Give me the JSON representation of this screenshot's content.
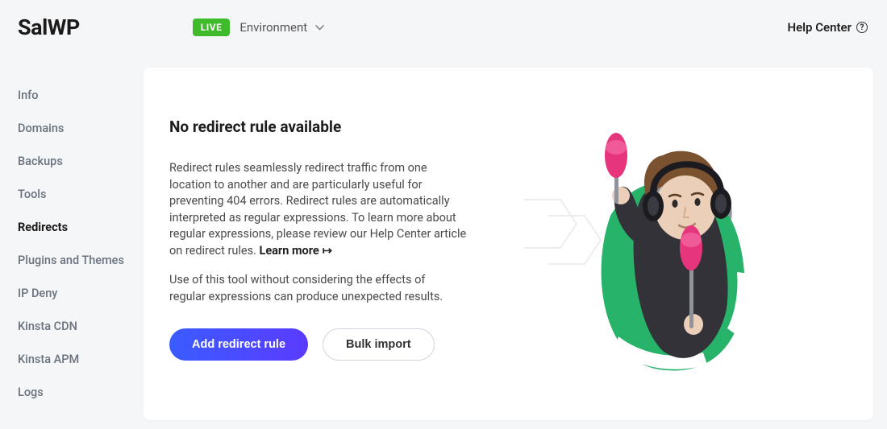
{
  "header": {
    "logo": "SalWP",
    "env_badge": "LIVE",
    "env_label": "Environment",
    "help_label": "Help Center",
    "help_glyph": "?"
  },
  "sidebar": {
    "items": [
      {
        "label": "Info",
        "active": false
      },
      {
        "label": "Domains",
        "active": false
      },
      {
        "label": "Backups",
        "active": false
      },
      {
        "label": "Tools",
        "active": false
      },
      {
        "label": "Redirects",
        "active": true
      },
      {
        "label": "Plugins and Themes",
        "active": false
      },
      {
        "label": "IP Deny",
        "active": false
      },
      {
        "label": "Kinsta CDN",
        "active": false
      },
      {
        "label": "Kinsta APM",
        "active": false
      },
      {
        "label": "Logs",
        "active": false
      }
    ]
  },
  "panel": {
    "title": "No redirect rule available",
    "description": "Redirect rules seamlessly redirect traffic from one location to another and are particularly useful for preventing 404 errors. Redirect rules are automatically interpreted as regular expressions. To learn more about regular expressions, please review our Help Center article on redirect rules. ",
    "learn_more": "Learn more",
    "warning": "Use of this tool without considering the effects of regular expressions can produce unexpected results.",
    "primary_btn": "Add redirect rule",
    "secondary_btn": "Bulk import"
  },
  "colors": {
    "primary_gradient_from": "#3a5cff",
    "primary_gradient_to": "#5b3bff",
    "badge_green": "#3fba2b"
  }
}
